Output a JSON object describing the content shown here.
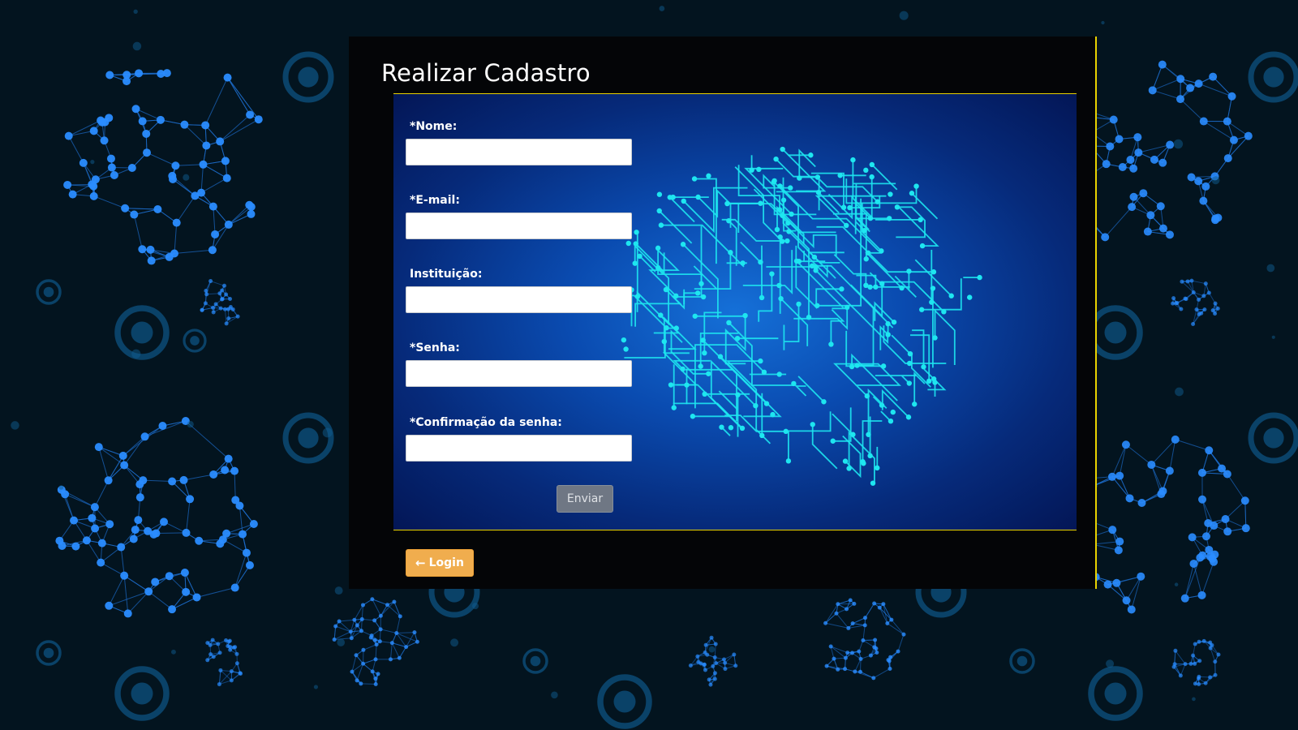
{
  "page": {
    "title": "Realizar Cadastro"
  },
  "form": {
    "fields": [
      {
        "label": "*Nome:",
        "value": "",
        "placeholder": ""
      },
      {
        "label": "*E-mail:",
        "value": "",
        "placeholder": ""
      },
      {
        "label": "Instituição:",
        "value": "",
        "placeholder": ""
      },
      {
        "label": "*Senha:",
        "value": "",
        "placeholder": ""
      },
      {
        "label": "*Confirmação da senha:",
        "value": "",
        "placeholder": ""
      }
    ],
    "submit_label": "Enviar"
  },
  "footer": {
    "login_label": "Login",
    "login_icon": "arrow-left-icon"
  },
  "colors": {
    "accent_line": "#e8d200",
    "login_button": "#f0ad4e",
    "submit_button": "#6f7784",
    "panel": "#040507",
    "circuit": "#1ee6f0"
  }
}
